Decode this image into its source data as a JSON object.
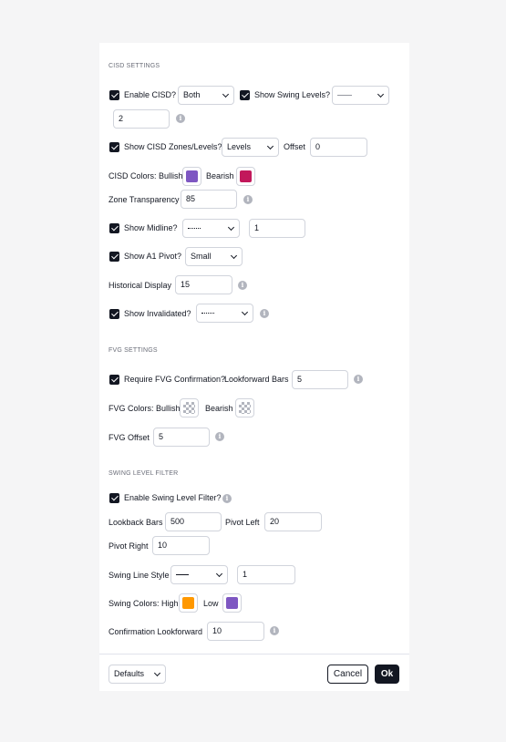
{
  "cisd": {
    "section_title": "CISD SETTINGS",
    "enable_cisd_label": "Enable CISD?",
    "enable_cisd_value": "Both",
    "show_swing_levels_label": "Show Swing Levels?",
    "swing_levels_width": "2",
    "show_zones_label": "Show CISD Zones/Levels?",
    "zones_value": "Levels",
    "offset_label": "Offset",
    "offset_value": "0",
    "colors_label": "CISD Colors: Bullish",
    "bearish_label": "Bearish",
    "zone_transparency_label": "Zone Transparency",
    "zone_transparency_value": "85",
    "show_midline_label": "Show Midline?",
    "midline_width": "1",
    "show_a1_pivot_label": "Show A1 Pivot?",
    "a1_pivot_value": "Small",
    "historical_display_label": "Historical Display",
    "historical_display_value": "15",
    "show_invalidated_label": "Show Invalidated?"
  },
  "fvg": {
    "section_title": "FVG SETTINGS",
    "require_confirmation_label": "Require FVG Confirmation?",
    "lookforward_label": "Lookforward Bars",
    "lookforward_value": "5",
    "colors_label": "FVG Colors: Bullish",
    "bearish_label": "Bearish",
    "offset_label": "FVG Offset",
    "offset_value": "5"
  },
  "swing": {
    "section_title": "SWING LEVEL FILTER",
    "enable_filter_label": "Enable Swing Level Filter?",
    "lookback_label": "Lookback Bars",
    "lookback_value": "500",
    "pivot_left_label": "Pivot Left",
    "pivot_left_value": "20",
    "pivot_right_label": "Pivot Right",
    "pivot_right_value": "10",
    "line_style_label": "Swing Line Style",
    "line_width_value": "1",
    "colors_label": "Swing Colors: High",
    "low_label": "Low",
    "confirmation_label": "Confirmation Lookforward",
    "confirmation_value": "10"
  },
  "footer": {
    "defaults_label": "Defaults",
    "cancel_label": "Cancel",
    "ok_label": "Ok"
  },
  "colors": {
    "cisd_bullish": "#7e57c2",
    "cisd_bearish": "#c2185b",
    "swing_high": "#ff9800",
    "swing_low": "#7e57c2"
  },
  "info_glyph": "i"
}
